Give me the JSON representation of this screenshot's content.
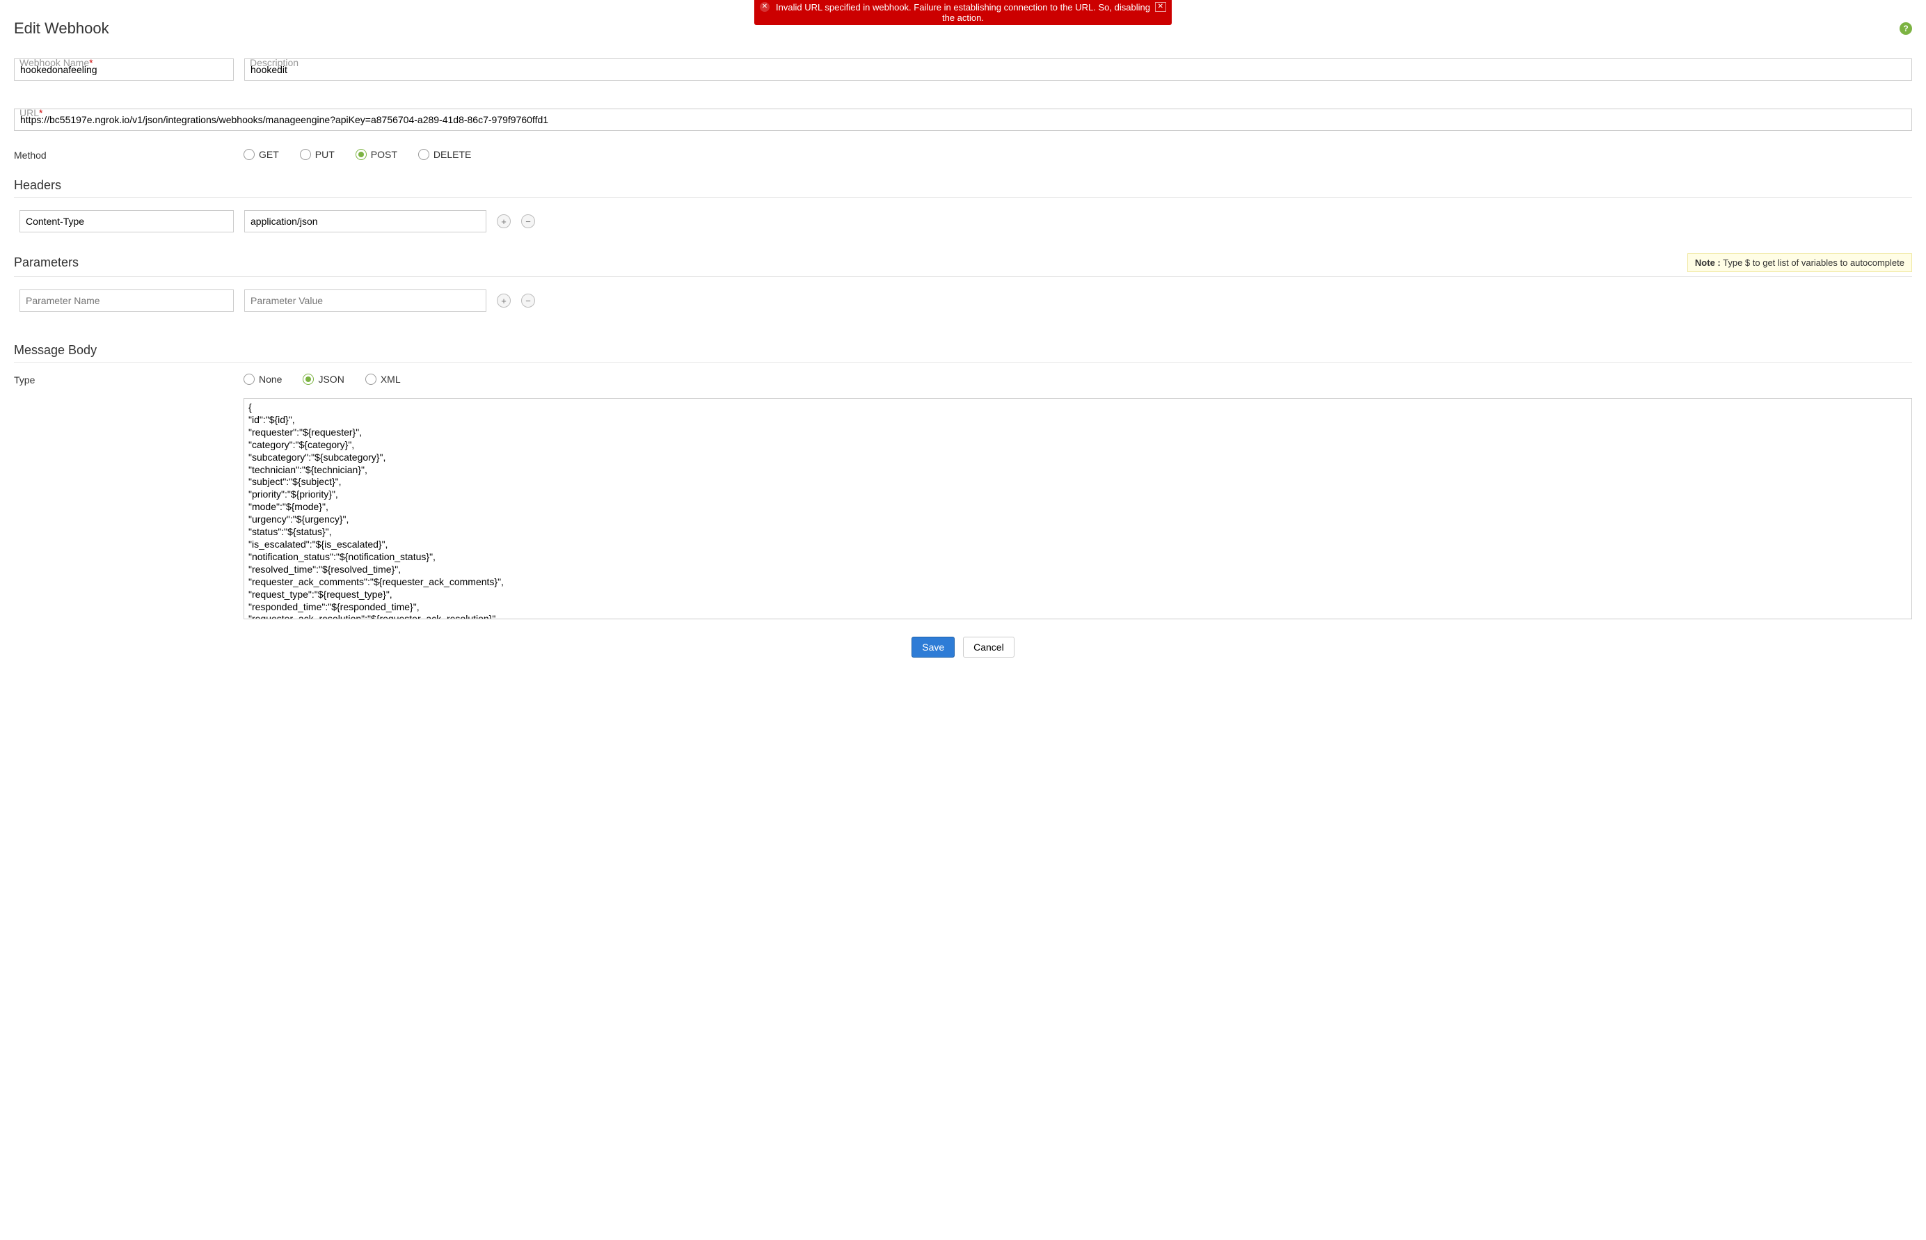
{
  "alert": {
    "message": "Invalid URL specified in webhook. Failure in establishing connection to the URL. So, disabling the action."
  },
  "page": {
    "title": "Edit Webhook"
  },
  "form": {
    "name_label": "Webhook Name",
    "name_value": "hookedonafeeling",
    "desc_label": "Description",
    "desc_value": "hookedit",
    "url_label": "URL",
    "url_value": "https://bc55197e.ngrok.io/v1/json/integrations/webhooks/manageengine?apiKey=a8756704-a289-41d8-86c7-979f9760ffd1",
    "method_label": "Method",
    "methods": {
      "get": "GET",
      "put": "PUT",
      "post": "POST",
      "delete": "DELETE",
      "selected": "POST"
    }
  },
  "headers": {
    "title": "Headers",
    "rows": [
      {
        "key": "Content-Type",
        "value": "application/json"
      }
    ]
  },
  "parameters": {
    "title": "Parameters",
    "note_label": "Note :",
    "note_text": " Type $ to get list of variables to autocomplete",
    "name_placeholder": "Parameter Name",
    "value_placeholder": "Parameter Value"
  },
  "body": {
    "title": "Message Body",
    "type_label": "Type",
    "types": {
      "none": "None",
      "json": "JSON",
      "xml": "XML",
      "selected": "JSON"
    },
    "content": "{\n\"id\":\"${id}\",\n\"requester\":\"${requester}\",\n\"category\":\"${category}\",\n\"subcategory\":\"${subcategory}\",\n\"technician\":\"${technician}\",\n\"subject\":\"${subject}\",\n\"priority\":\"${priority}\",\n\"mode\":\"${mode}\",\n\"urgency\":\"${urgency}\",\n\"status\":\"${status}\",\n\"is_escalated\":\"${is_escalated}\",\n\"notification_status\":\"${notification_status}\",\n\"resolved_time\":\"${resolved_time}\",\n\"requester_ack_comments\":\"${requester_ack_comments}\",\n\"request_type\":\"${request_type}\",\n\"responded_time\":\"${responded_time}\",\n\"requester_ack_resolution\":\"${requester_ack_resolution}\","
  },
  "footer": {
    "save": "Save",
    "cancel": "Cancel"
  }
}
